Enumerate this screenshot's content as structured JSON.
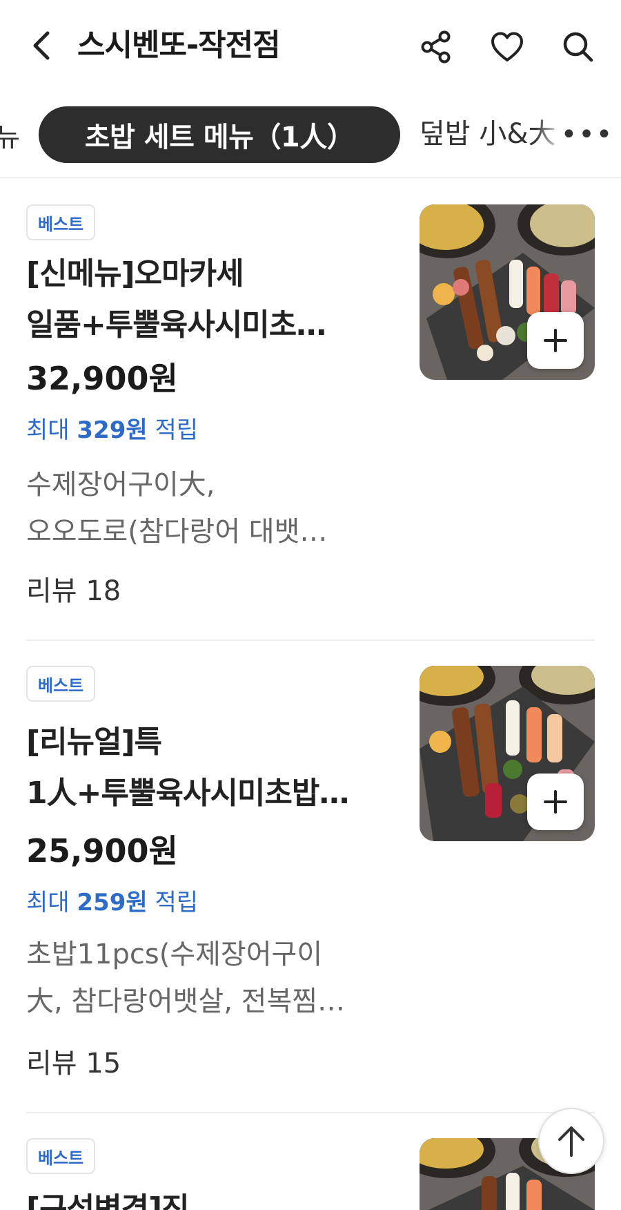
{
  "header": {
    "title": "스시벤또-작전점",
    "back_icon": "chevron-left-icon",
    "share_icon": "share-icon",
    "heart_icon": "heart-icon",
    "search_icon": "search-icon"
  },
  "tabs": {
    "prev_partial": "뉴",
    "active": "초밥 세트 메뉴（1人）",
    "next_partial": "덮밥 小&大",
    "more": "•••"
  },
  "items": [
    {
      "badge": "베스트",
      "name_line1": "[신메뉴]오마카세",
      "name_line2": "일품+투뿔육사시미초…",
      "price": "32,900원",
      "points_prefix": "최대 ",
      "points_amount": "329원",
      "points_suffix": " 적립",
      "desc_line1": "수제장어구이大,",
      "desc_line2": "오오도로(참다랑어 대뱃…",
      "reviews": "리뷰 18",
      "photo": "sushi-platter-image"
    },
    {
      "badge": "베스트",
      "name_line1": "[리뉴얼]특",
      "name_line2": "1人+투뿔육사시미초밥…",
      "price": "25,900원",
      "points_prefix": "최대 ",
      "points_amount": "259원",
      "points_suffix": " 적립",
      "desc_line1": "초밥11pcs(수제장어구이",
      "desc_line2": "大, 참다랑어뱃살, 전복찜…",
      "reviews": "리뷰 15",
      "photo": "sushi-platter-image"
    },
    {
      "badge": "베스트",
      "name_line1": "[구성변경]진",
      "photo": "sushi-platter-image"
    }
  ],
  "colors": {
    "accent_blue": "#2e6bc8",
    "active_tab_bg": "#2d2d2d"
  },
  "scroll_top_icon": "arrow-up-icon"
}
